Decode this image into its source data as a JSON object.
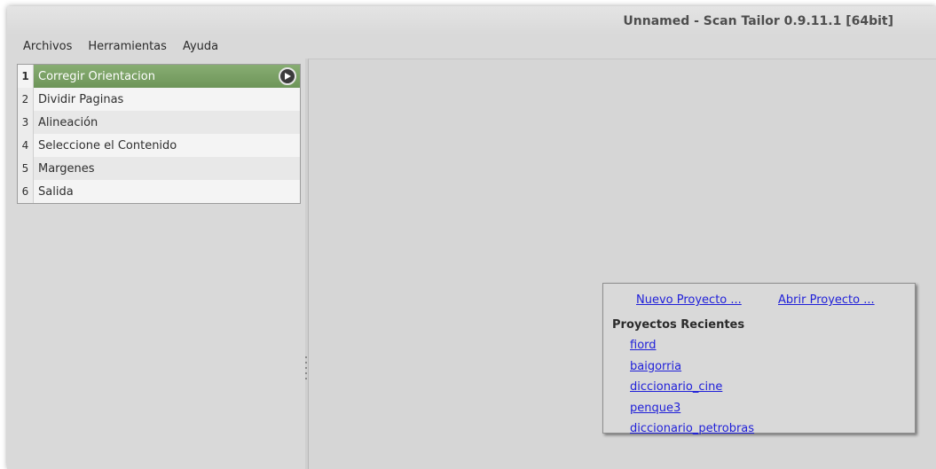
{
  "window": {
    "title": "Unnamed - Scan Tailor 0.9.11.1 [64bit]"
  },
  "menu": {
    "items": [
      "Archivos",
      "Herramientas",
      "Ayuda"
    ]
  },
  "stages": [
    {
      "num": "1",
      "label": "Corregir Orientacion",
      "active": true
    },
    {
      "num": "2",
      "label": "Dividir Paginas"
    },
    {
      "num": "3",
      "label": "Alineación"
    },
    {
      "num": "4",
      "label": "Seleccione el Contenido"
    },
    {
      "num": "5",
      "label": "Margenes"
    },
    {
      "num": "6",
      "label": "Salida"
    }
  ],
  "welcome": {
    "new_project": "Nuevo Proyecto ...",
    "open_project": "Abrir Proyecto ...",
    "recent_heading": "Proyectos Recientes",
    "recent": [
      "fiord",
      "baigorria",
      "diccionario_cine",
      "penque3",
      "diccionario_petrobras"
    ]
  },
  "colors": {
    "active_stage": "#7aa266",
    "link": "#1f1fd9",
    "window_bg": "#d9d9d9"
  },
  "icons": {
    "play": "play-icon"
  }
}
